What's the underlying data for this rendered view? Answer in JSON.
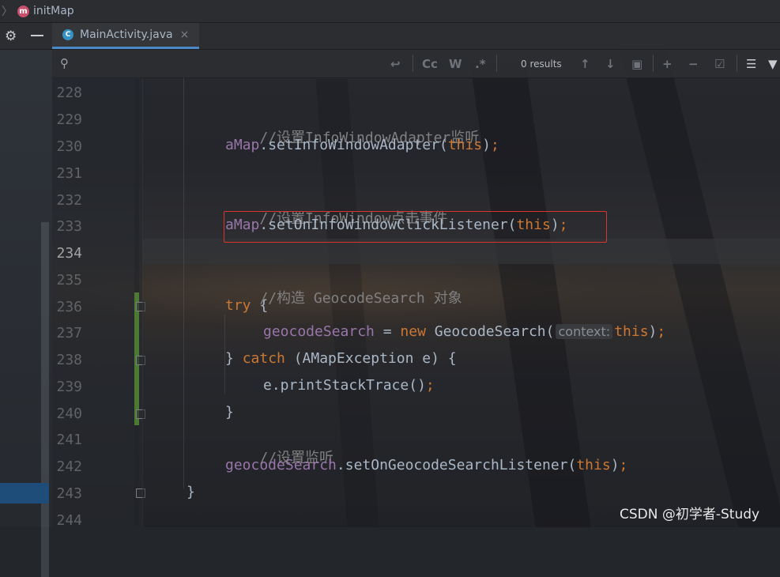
{
  "breadcrumb": {
    "method_icon": "m",
    "method": "initMap"
  },
  "editor_tab": {
    "class_icon": "C",
    "filename": "MainActivity.java",
    "close": "×"
  },
  "find_bar": {
    "results": "0 results",
    "match_case": "Cc",
    "words": "W",
    "regex": ".*"
  },
  "gutter": {
    "line_numbers": [
      "228",
      "229",
      "230",
      "231",
      "232",
      "233",
      "234",
      "235",
      "236",
      "237",
      "238",
      "239",
      "240",
      "241",
      "242",
      "243",
      "244"
    ],
    "current_line": "234"
  },
  "code": {
    "c229": "//设置InfoWindowAdapter监听",
    "c230_obj": "aMap",
    "c230_call": ".setInfoWindowAdapter(",
    "c230_this": "this",
    "c230_end": ")",
    "c230_semi": ";",
    "c232": "//设置InfoWindow点击事件",
    "c233_obj": "aMap",
    "c233_call": ".setOnInfoWindowClickListener(",
    "c233_this": "this",
    "c233_end": ")",
    "c233_semi": ";",
    "c235": "//构造 GeocodeSearch 对象",
    "c236_try": "try",
    "c236_brace": " {",
    "c237_field": "geocodeSearch",
    "c237_eq": " = ",
    "c237_new": "new",
    "c237_ctor": " GeocodeSearch(",
    "c237_hint": "context:",
    "c237_this": "this",
    "c237_end": ")",
    "c237_semi": ";",
    "c238_close": "} ",
    "c238_catch": "catch",
    "c238_rest": " (AMapException e) {",
    "c239_call": "e.printStackTrace()",
    "c239_semi": ";",
    "c240": "}",
    "c241": "//设置监听",
    "c242_field": "geocodeSearch",
    "c242_call": ".setOnGeocodeSearchListener(",
    "c242_this": "this",
    "c242_end": ")",
    "c242_semi": ";",
    "c243": "}"
  },
  "watermark": "CSDN @初学者-Study",
  "colors": {
    "keyword": "#cc7832",
    "field": "#9876aa",
    "comment": "#808080",
    "text": "#a9b7c6",
    "highlight_border": "#d8362a"
  }
}
